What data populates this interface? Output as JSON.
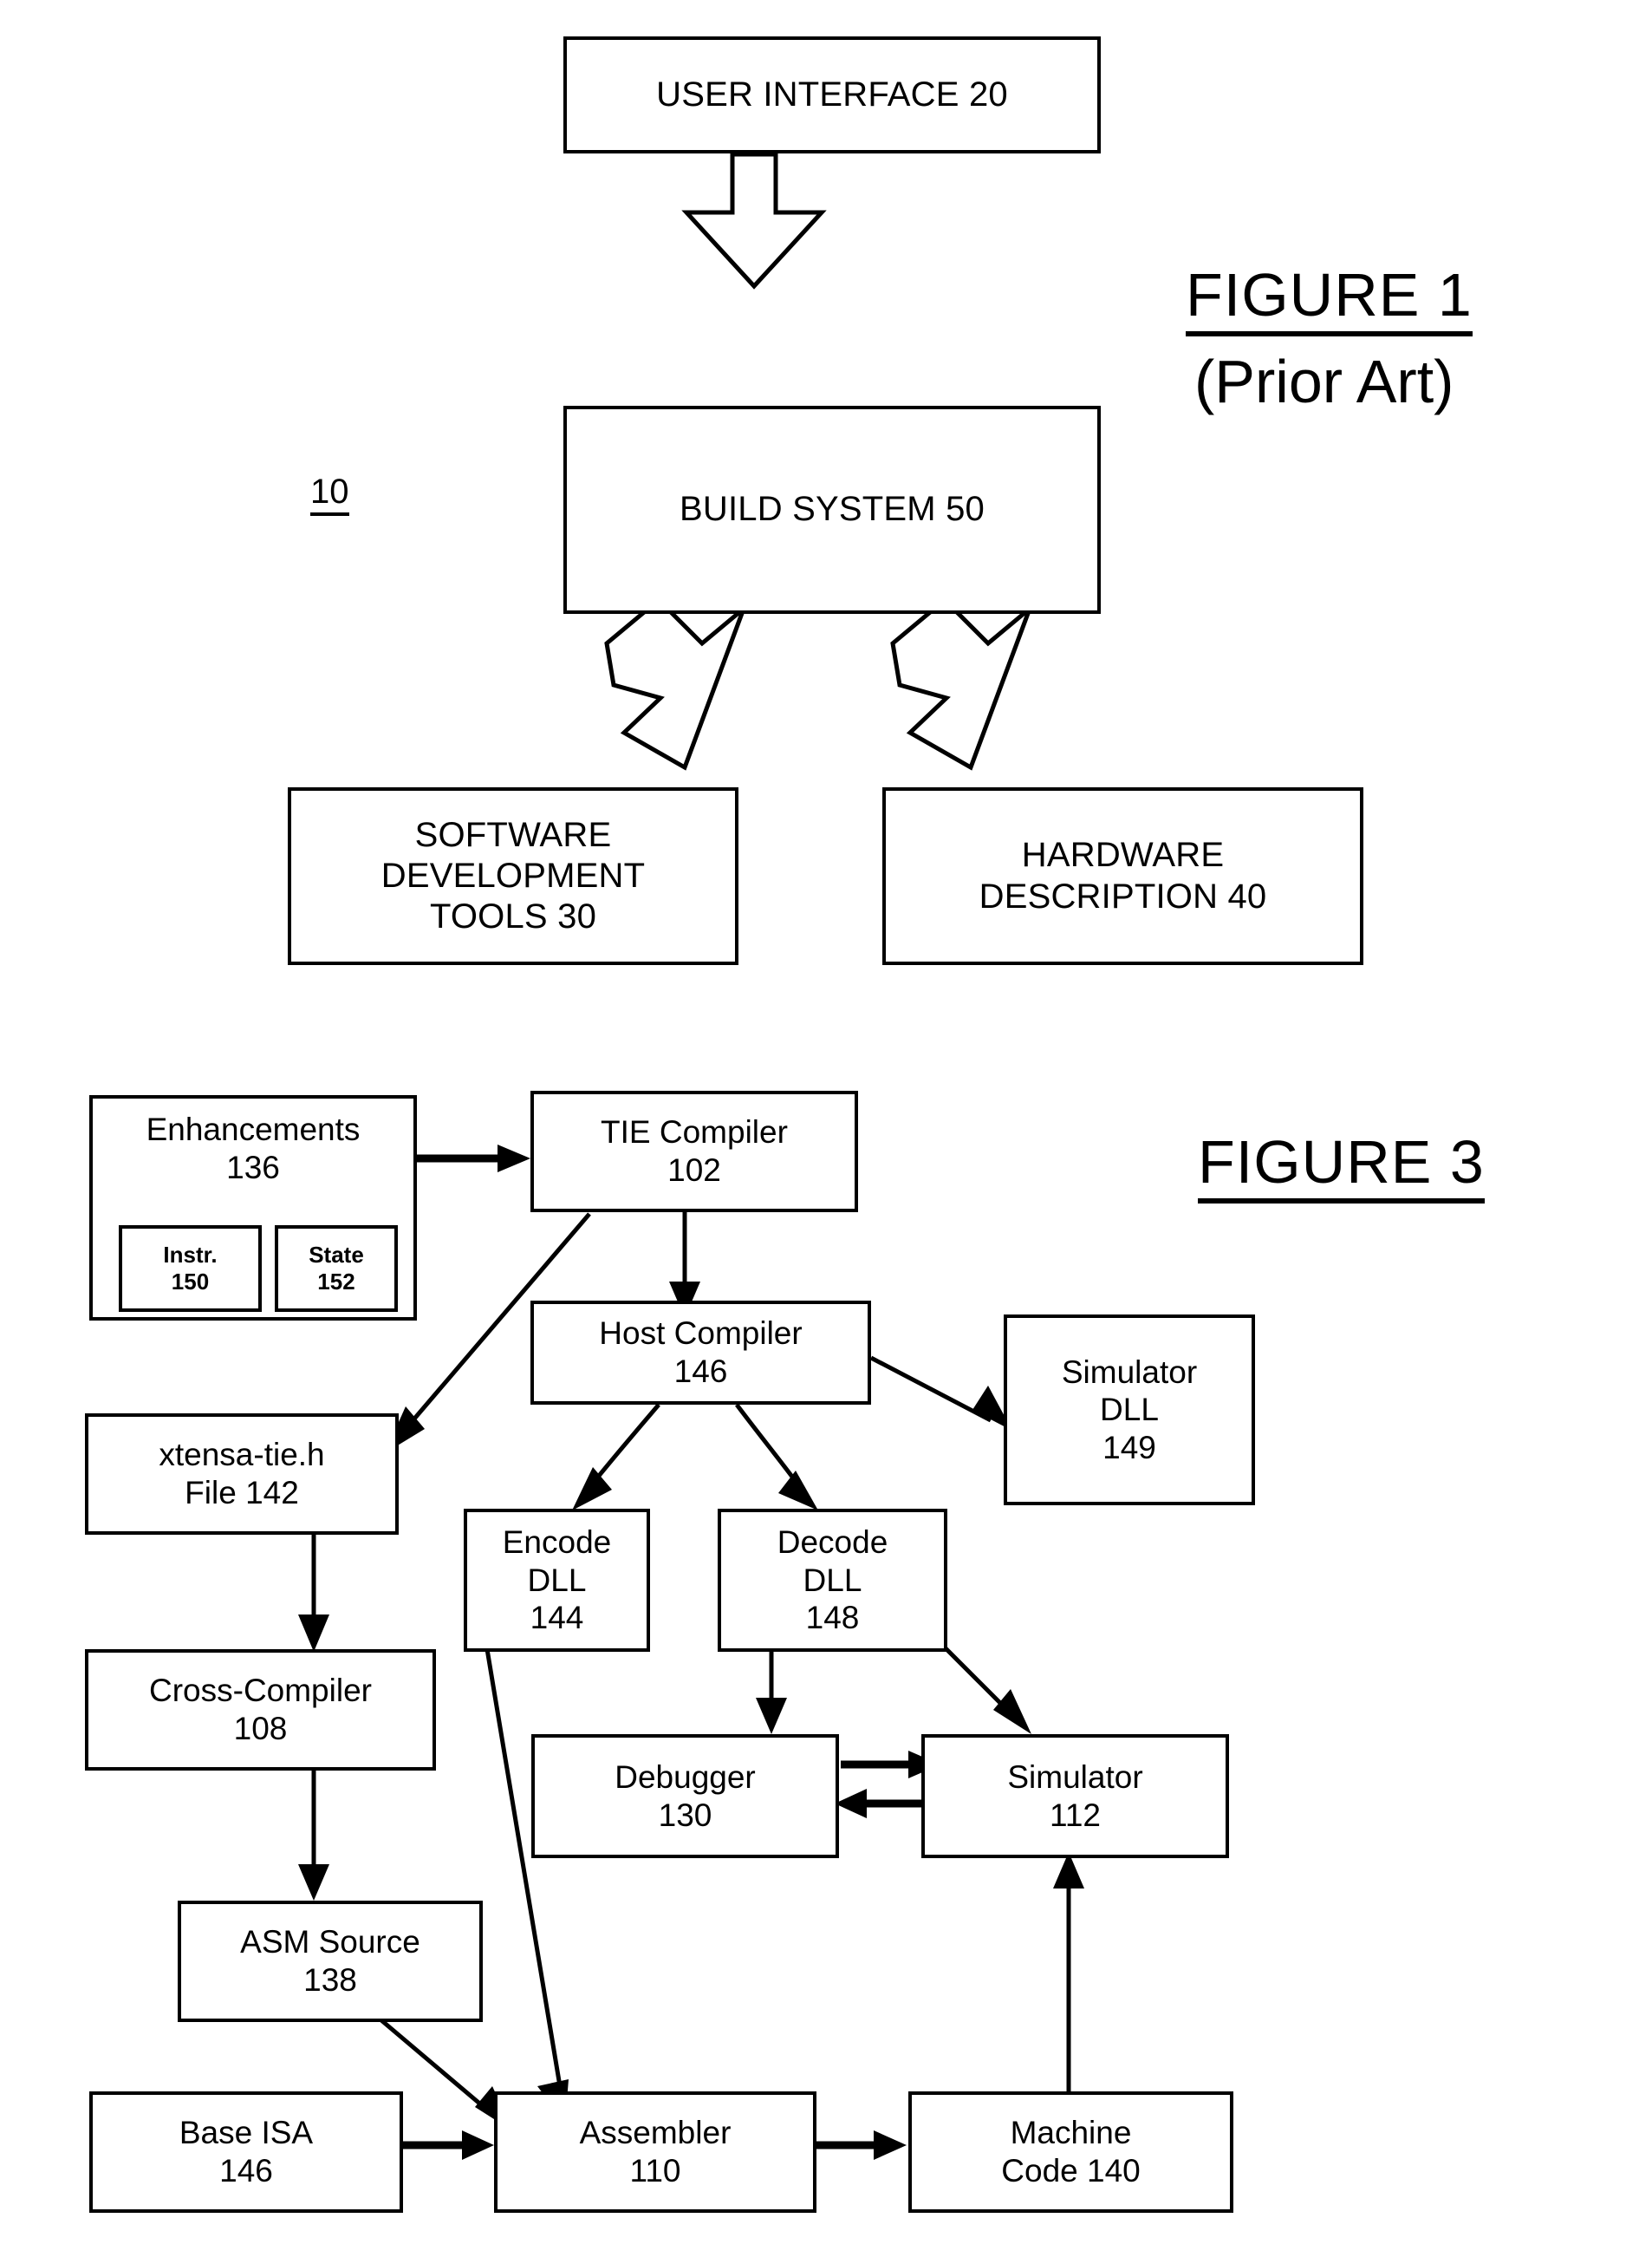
{
  "figure1": {
    "title": "FIGURE 1",
    "subtitle": "(Prior Art)",
    "callout": "10",
    "boxes": {
      "user_interface": "USER INTERFACE 20",
      "build_system": "BUILD SYSTEM 50",
      "software_tools_line1": "SOFTWARE",
      "software_tools_line2": "DEVELOPMENT",
      "software_tools_line3": "TOOLS 30",
      "hardware_desc_line1": "HARDWARE",
      "hardware_desc_line2": "DESCRIPTION 40"
    }
  },
  "figure3": {
    "title": "FIGURE 3",
    "boxes": {
      "enhancements_line1": "Enhancements",
      "enhancements_line2": "136",
      "instr_line1": "Instr.",
      "instr_line2": "150",
      "state_line1": "State",
      "state_line2": "152",
      "tie_compiler_line1": "TIE Compiler",
      "tie_compiler_line2": "102",
      "host_compiler_line1": "Host Compiler",
      "host_compiler_line2": "146",
      "simulator_dll_line1": "Simulator",
      "simulator_dll_line2": "DLL",
      "simulator_dll_line3": "149",
      "xtensa_tie_line1": "xtensa-tie.h",
      "xtensa_tie_line2": "File 142",
      "encode_dll_line1": "Encode",
      "encode_dll_line2": "DLL",
      "encode_dll_line3": "144",
      "decode_dll_line1": "Decode",
      "decode_dll_line2": "DLL",
      "decode_dll_line3": "148",
      "cross_compiler_line1": "Cross-Compiler",
      "cross_compiler_line2": "108",
      "debugger_line1": "Debugger",
      "debugger_line2": "130",
      "simulator_line1": "Simulator",
      "simulator_line2": "112",
      "asm_source_line1": "ASM Source",
      "asm_source_line2": "138",
      "base_isa_line1": "Base ISA",
      "base_isa_line2": "146",
      "assembler_line1": "Assembler",
      "assembler_line2": "110",
      "machine_code_line1": "Machine",
      "machine_code_line2": "Code 140"
    }
  },
  "colors": {
    "ink": "#000000",
    "paper": "#ffffff"
  }
}
